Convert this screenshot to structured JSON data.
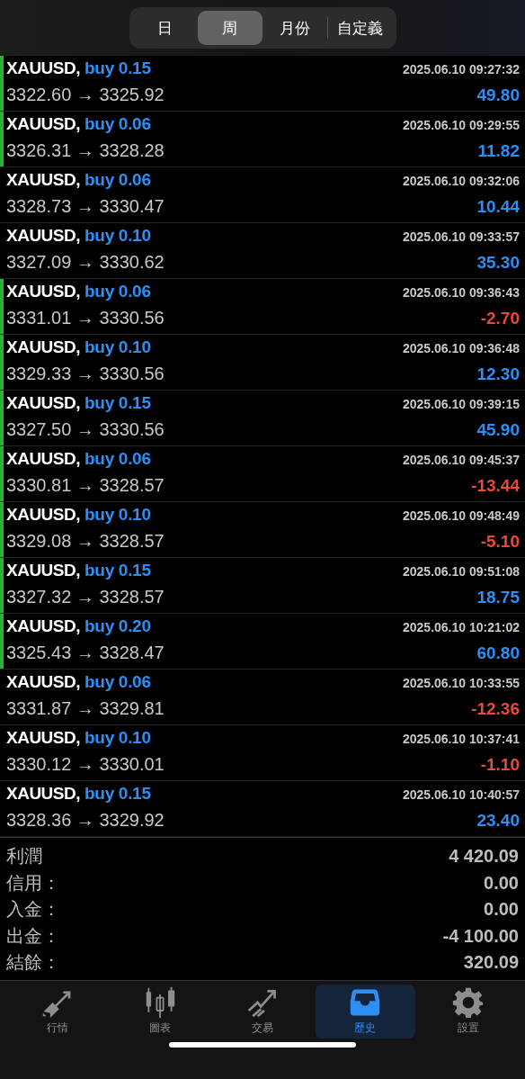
{
  "periods": [
    {
      "label": "日",
      "selected": false
    },
    {
      "label": "周",
      "selected": true
    },
    {
      "label": "月份",
      "selected": false
    },
    {
      "label": "自定義",
      "selected": false
    }
  ],
  "trades": [
    {
      "symbol": "XAUUSD,",
      "side": "buy 0.15",
      "time": "2025.06.10 09:27:32",
      "prices": "3322.60 → 3325.92",
      "profit": "49.80",
      "loss": false,
      "marked": true
    },
    {
      "symbol": "XAUUSD,",
      "side": "buy 0.06",
      "time": "2025.06.10 09:29:55",
      "prices": "3326.31 → 3328.28",
      "profit": "11.82",
      "loss": false,
      "marked": true
    },
    {
      "symbol": "XAUUSD,",
      "side": "buy 0.06",
      "time": "2025.06.10 09:32:06",
      "prices": "3328.73 → 3330.47",
      "profit": "10.44",
      "loss": false,
      "marked": false
    },
    {
      "symbol": "XAUUSD,",
      "side": "buy 0.10",
      "time": "2025.06.10 09:33:57",
      "prices": "3327.09 → 3330.62",
      "profit": "35.30",
      "loss": false,
      "marked": false
    },
    {
      "symbol": "XAUUSD,",
      "side": "buy 0.06",
      "time": "2025.06.10 09:36:43",
      "prices": "3331.01 → 3330.56",
      "profit": "-2.70",
      "loss": true,
      "marked": true
    },
    {
      "symbol": "XAUUSD,",
      "side": "buy 0.10",
      "time": "2025.06.10 09:36:48",
      "prices": "3329.33 → 3330.56",
      "profit": "12.30",
      "loss": false,
      "marked": true
    },
    {
      "symbol": "XAUUSD,",
      "side": "buy 0.15",
      "time": "2025.06.10 09:39:15",
      "prices": "3327.50 → 3330.56",
      "profit": "45.90",
      "loss": false,
      "marked": true
    },
    {
      "symbol": "XAUUSD,",
      "side": "buy 0.06",
      "time": "2025.06.10 09:45:37",
      "prices": "3330.81 → 3328.57",
      "profit": "-13.44",
      "loss": true,
      "marked": true
    },
    {
      "symbol": "XAUUSD,",
      "side": "buy 0.10",
      "time": "2025.06.10 09:48:49",
      "prices": "3329.08 → 3328.57",
      "profit": "-5.10",
      "loss": true,
      "marked": true
    },
    {
      "symbol": "XAUUSD,",
      "side": "buy 0.15",
      "time": "2025.06.10 09:51:08",
      "prices": "3327.32 → 3328.57",
      "profit": "18.75",
      "loss": false,
      "marked": true
    },
    {
      "symbol": "XAUUSD,",
      "side": "buy 0.20",
      "time": "2025.06.10 10:21:02",
      "prices": "3325.43 → 3328.47",
      "profit": "60.80",
      "loss": false,
      "marked": true
    },
    {
      "symbol": "XAUUSD,",
      "side": "buy 0.06",
      "time": "2025.06.10 10:33:55",
      "prices": "3331.87 → 3329.81",
      "profit": "-12.36",
      "loss": true,
      "marked": false
    },
    {
      "symbol": "XAUUSD,",
      "side": "buy 0.10",
      "time": "2025.06.10 10:37:41",
      "prices": "3330.12 → 3330.01",
      "profit": "-1.10",
      "loss": true,
      "marked": false
    },
    {
      "symbol": "XAUUSD,",
      "side": "buy 0.15",
      "time": "2025.06.10 10:40:57",
      "prices": "3328.36 → 3329.92",
      "profit": "23.40",
      "loss": false,
      "marked": false
    }
  ],
  "summary": [
    {
      "label": "利潤",
      "value": "4 420.09"
    },
    {
      "label": "信用：",
      "value": "0.00"
    },
    {
      "label": "入金：",
      "value": "0.00"
    },
    {
      "label": "出金：",
      "value": "-4 100.00"
    },
    {
      "label": "結餘：",
      "value": "320.09"
    }
  ],
  "tab_bar": [
    {
      "label": "行情",
      "kind": "quotes",
      "selected": false
    },
    {
      "label": "圖表",
      "kind": "chart",
      "selected": false
    },
    {
      "label": "交易",
      "kind": "trade",
      "selected": false
    },
    {
      "label": "歷史",
      "kind": "history",
      "selected": true
    },
    {
      "label": "設置",
      "kind": "settings",
      "selected": false
    }
  ]
}
